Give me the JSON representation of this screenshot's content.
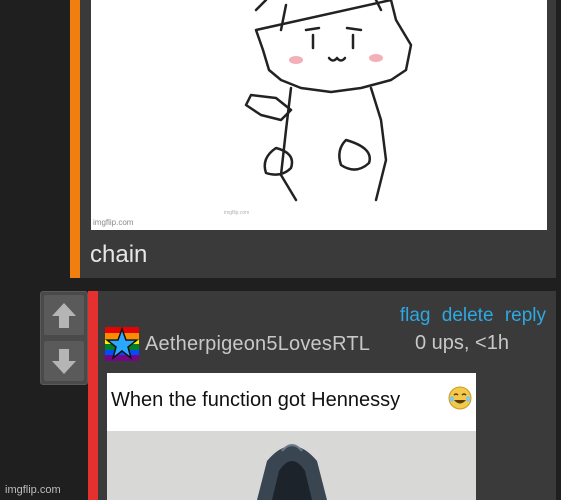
{
  "parent_comment": {
    "text": "chain",
    "image": {
      "watermark_primary": "imgflip.com",
      "watermark_secondary": "imgflip.com"
    },
    "accent_color": "#f07f10"
  },
  "reply_comment": {
    "accent_color": "#e53030",
    "actions": {
      "flag": "flag",
      "delete": "delete",
      "reply": "reply"
    },
    "username": "Aetherpigeon5LovesRTL",
    "meta": "0 ups, <1h",
    "avatar_icon": "rainbow-star-icon",
    "meme": {
      "caption": "When the function got Hennessy"
    }
  },
  "votes": {
    "up_icon": "arrow-up-icon",
    "down_icon": "arrow-down-icon"
  },
  "footer_watermark": "imgflip.com",
  "colors": {
    "link": "#2da8e2",
    "panel": "#3a3a3a",
    "background": "#1f1f1f"
  }
}
